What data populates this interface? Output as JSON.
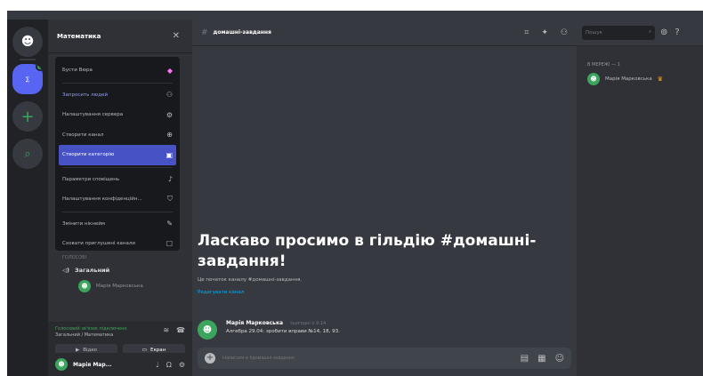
{
  "colors": {
    "accent": "#5865f2",
    "online": "#3ba55d",
    "boost": "#ff73fa",
    "link": "#00aff4"
  },
  "guild": {
    "name": "Математика"
  },
  "menu": {
    "items": [
      {
        "label": "Бусти Вюра",
        "icon": "boost-icon"
      },
      {
        "label": "Запросить людей",
        "icon": "add-person-icon"
      },
      {
        "label": "Налаштування сервера",
        "icon": "gear-icon"
      },
      {
        "label": "Створити канал",
        "icon": "plus-circle-icon"
      },
      {
        "label": "Створити категорію",
        "icon": "folder-plus-icon"
      },
      {
        "label": "Параметри сповіщень",
        "icon": "bell-icon"
      },
      {
        "label": "Налаштування конфіденційн...",
        "icon": "shield-icon"
      },
      {
        "label": "Змінити нікнейм",
        "icon": "pencil-icon"
      },
      {
        "label": "Сховати приглушені канали",
        "icon": "checkbox-icon"
      }
    ]
  },
  "channels": {
    "category": "ГОЛОСОВІ",
    "voice_channel": "Загальний",
    "voice_user": "Марія Марковська"
  },
  "voice_panel": {
    "status": "Голосовий зв'язок підключено",
    "sub": "Загальний / Математика",
    "video_label": "Відео",
    "screen_label": "Екран"
  },
  "user": {
    "name": "Марія Мар..."
  },
  "main": {
    "channel": "домашні-завдання",
    "welcome_title": "Ласкаво просимо в гільдію #домашні-завдання!",
    "welcome_sub": "Це початок каналу #домашні-завдання.",
    "welcome_link": "Редагувати канал",
    "message": {
      "author": "Марія Марковська",
      "time": "сьогодні о 9:14",
      "text": "Алгебра 29.04: зробити вправи №14, 18, 93."
    },
    "composer_placeholder": "Написати в #домашні-завдання"
  },
  "search": {
    "placeholder": "Пошук"
  },
  "members": {
    "category": "В МЕРЕЖІ — 1",
    "list": [
      {
        "name": "Марія Марковська"
      }
    ]
  }
}
